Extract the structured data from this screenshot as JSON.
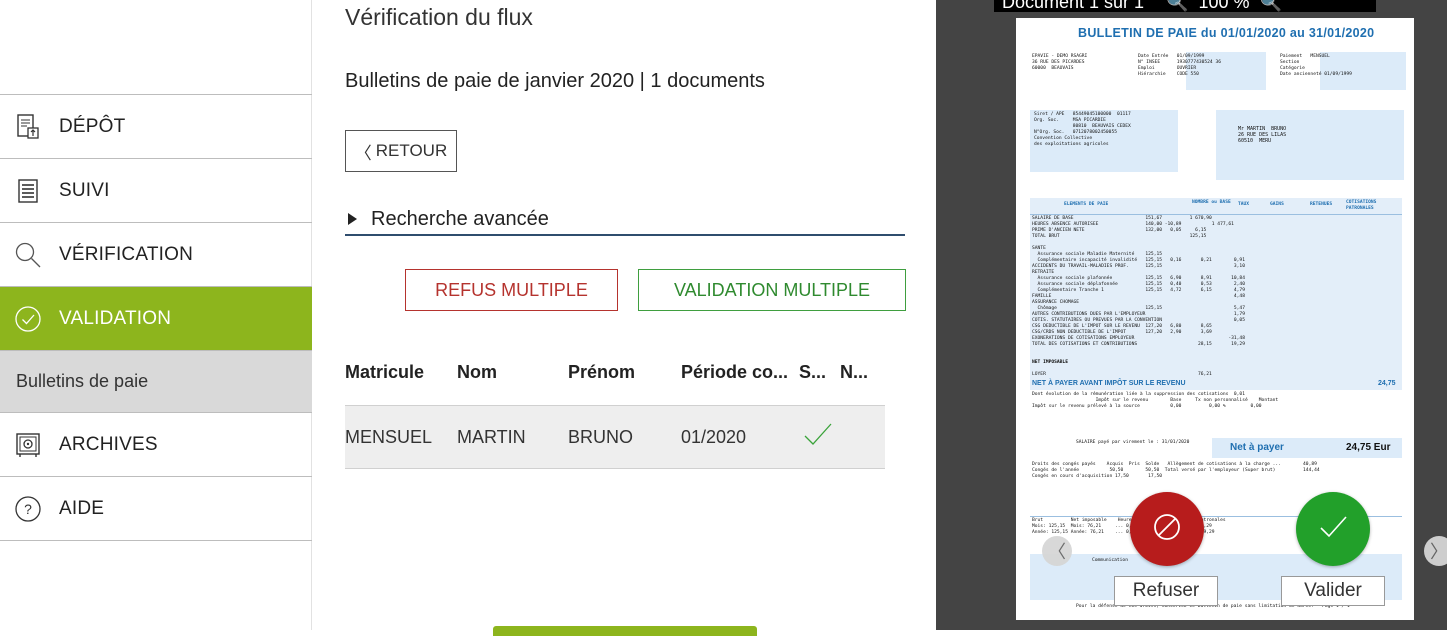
{
  "sidebar": {
    "items": [
      {
        "label": "DÉPÔT",
        "icon": "deposit-icon"
      },
      {
        "label": "SUIVI",
        "icon": "list-icon"
      },
      {
        "label": "VÉRIFICATION",
        "icon": "search-icon"
      },
      {
        "label": "VALIDATION",
        "icon": "check-circle-icon",
        "active": true
      },
      {
        "label": "ARCHIVES",
        "icon": "safe-icon"
      },
      {
        "label": "AIDE",
        "icon": "help-icon"
      }
    ],
    "sub_item": "Bulletins de paie",
    "active_color": "#8db51d"
  },
  "main": {
    "title": "Vérification du flux",
    "subtitle": "Bulletins de paie de janvier 2020 | 1 documents",
    "back_label": "RETOUR",
    "advanced_search": "Recherche avancée",
    "refuse_multiple": "REFUS MULTIPLE",
    "validate_multiple": "VALIDATION MULTIPLE",
    "table": {
      "headers": [
        "Matricule",
        "Nom",
        "Prénom",
        "Période co...",
        "S...",
        "N..."
      ],
      "rows": [
        {
          "matricule": "MENSUEL",
          "nom": "MARTIN",
          "prenom": "BRUNO",
          "periode": "01/2020",
          "status_icon": "check-icon"
        }
      ]
    }
  },
  "viewer": {
    "toolbar_text": "Document 1 sur 1",
    "zoom_text": "100 %",
    "doc": {
      "title": "BULLETIN DE PAIE du  01/01/2020  au  31/01/2020",
      "net_label": "Net à payer",
      "net_value": "24,75 Eur",
      "net_before_tax": "NET À PAYER AVANT IMPÔT SUR LE REVENU",
      "net_before_tax_value": "24,75",
      "paid_on": "SALAIRE payé par virement le : 31/01/2020",
      "net_taxable": "NET IMPOSABLE",
      "col_headers": [
        "ELEMENTS DE PAIE",
        "NOMBRE ou BASE",
        "TAUX",
        "GAINS",
        "RETENUES",
        "COTISATIONS PATRONALES"
      ]
    },
    "refuse_label": "Refuser",
    "validate_label": "Valider",
    "refuse_color": "#b71c1c",
    "validate_color": "#22a02a"
  }
}
